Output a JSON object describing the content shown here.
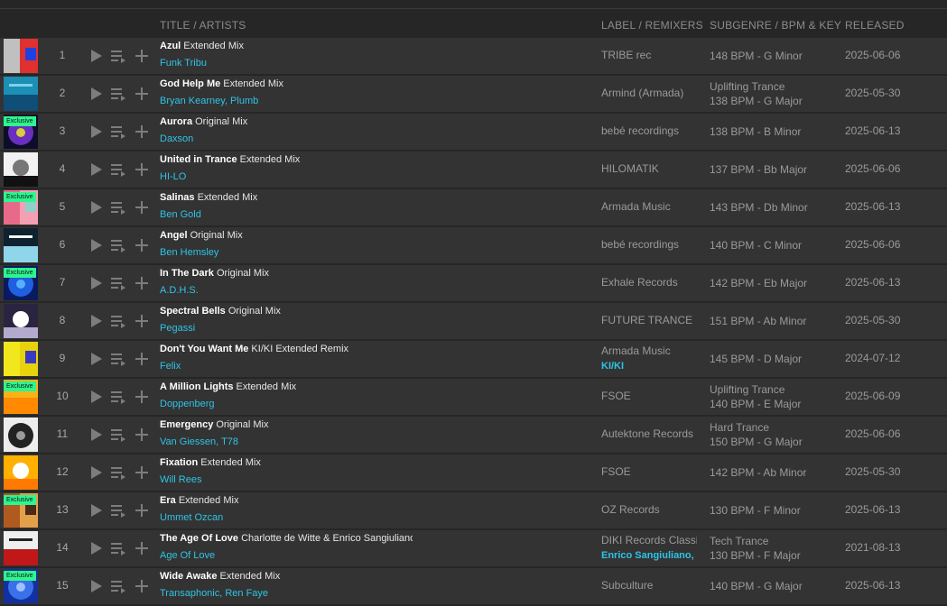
{
  "columns": {
    "title": "TITLE / ARTISTS",
    "label": "LABEL / REMIXERS",
    "genre": "SUBGENRE / BPM & KEY",
    "released": "RELEASED"
  },
  "exclusive_badge": "Exclusive",
  "colors": {
    "row_bg": "#333333",
    "page_bg": "#262626",
    "accent_artist": "#2ec4e6",
    "exclusive_badge": "#2ef58f"
  },
  "tracks": [
    {
      "num": "1",
      "title": "Azul",
      "mix": "Extended Mix",
      "artists": "Funk Tribu",
      "label": "TRIBE rec",
      "remixer": "",
      "subgenre": "",
      "bpm_key": "148 BPM - G Minor",
      "released": "2025-06-06",
      "exclusive": false
    },
    {
      "num": "2",
      "title": "God Help Me",
      "mix": "Extended Mix",
      "artists": "Bryan Kearney, Plumb",
      "label": "Armind (Armada)",
      "remixer": "",
      "subgenre": "Uplifting Trance",
      "bpm_key": "138 BPM - G Major",
      "released": "2025-05-30",
      "exclusive": false
    },
    {
      "num": "3",
      "title": "Aurora",
      "mix": "Original Mix",
      "artists": "Daxson",
      "label": "bebé recordings",
      "remixer": "",
      "subgenre": "",
      "bpm_key": "138 BPM - B Minor",
      "released": "2025-06-13",
      "exclusive": true
    },
    {
      "num": "4",
      "title": "United in Trance",
      "mix": "Extended Mix",
      "artists": "HI-LO",
      "label": "HILOMATIK",
      "remixer": "",
      "subgenre": "",
      "bpm_key": "137 BPM - Bb Major",
      "released": "2025-06-06",
      "exclusive": false
    },
    {
      "num": "5",
      "title": "Salinas",
      "mix": "Extended Mix",
      "artists": "Ben Gold",
      "label": "Armada Music",
      "remixer": "",
      "subgenre": "",
      "bpm_key": "143 BPM - Db Minor",
      "released": "2025-06-13",
      "exclusive": true
    },
    {
      "num": "6",
      "title": "Angel",
      "mix": "Original Mix",
      "artists": "Ben Hemsley",
      "label": "bebé recordings",
      "remixer": "",
      "subgenre": "",
      "bpm_key": "140 BPM - C Minor",
      "released": "2025-06-06",
      "exclusive": false
    },
    {
      "num": "7",
      "title": "In The Dark",
      "mix": "Original Mix",
      "artists": "A.D.H.S.",
      "label": "Exhale Records",
      "remixer": "",
      "subgenre": "",
      "bpm_key": "142 BPM - Eb Major",
      "released": "2025-06-13",
      "exclusive": true
    },
    {
      "num": "8",
      "title": "Spectral Bells",
      "mix": "Original Mix",
      "artists": "Pegassi",
      "label": "FUTURE TRANCE",
      "remixer": "",
      "subgenre": "",
      "bpm_key": "151 BPM - Ab Minor",
      "released": "2025-05-30",
      "exclusive": false
    },
    {
      "num": "9",
      "title": "Don't You Want Me",
      "mix": "KI/KI Extended Remix",
      "artists": "Felix",
      "label": "Armada Music",
      "remixer": "KI/KI",
      "subgenre": "",
      "bpm_key": "145 BPM - D Major",
      "released": "2024-07-12",
      "exclusive": false
    },
    {
      "num": "10",
      "title": "A Million Lights",
      "mix": "Extended Mix",
      "artists": "Doppenberg",
      "label": "FSOE",
      "remixer": "",
      "subgenre": "Uplifting Trance",
      "bpm_key": "140 BPM - E Major",
      "released": "2025-06-09",
      "exclusive": true
    },
    {
      "num": "11",
      "title": "Emergency",
      "mix": "Original Mix",
      "artists": "Van Giessen, T78",
      "label": "Autektone Records",
      "remixer": "",
      "subgenre": "Hard Trance",
      "bpm_key": "150 BPM - G Major",
      "released": "2025-06-06",
      "exclusive": false
    },
    {
      "num": "12",
      "title": "Fixation",
      "mix": "Extended Mix",
      "artists": "Will Rees",
      "label": "FSOE",
      "remixer": "",
      "subgenre": "",
      "bpm_key": "142 BPM - Ab Minor",
      "released": "2025-05-30",
      "exclusive": false
    },
    {
      "num": "13",
      "title": "Era",
      "mix": "Extended Mix",
      "artists": "Ummet Ozcan",
      "label": "OZ Records",
      "remixer": "",
      "subgenre": "",
      "bpm_key": "130 BPM - F Minor",
      "released": "2025-06-13",
      "exclusive": true
    },
    {
      "num": "14",
      "title": "The Age Of Love",
      "mix": "Charlotte de Witte & Enrico Sangiuliano Remix",
      "artists": "Age Of Love",
      "label": "DIKI Records Classics",
      "remixer": "Enrico Sangiuliano, Charlotte de Witte",
      "subgenre": "Tech Trance",
      "bpm_key": "130 BPM - F Major",
      "released": "2021-08-13",
      "exclusive": false
    },
    {
      "num": "15",
      "title": "Wide Awake",
      "mix": "Extended Mix",
      "artists": "Transaphonic, Ren Faye",
      "label": "Subculture",
      "remixer": "",
      "subgenre": "",
      "bpm_key": "140 BPM - G Major",
      "released": "2025-06-13",
      "exclusive": true
    }
  ]
}
